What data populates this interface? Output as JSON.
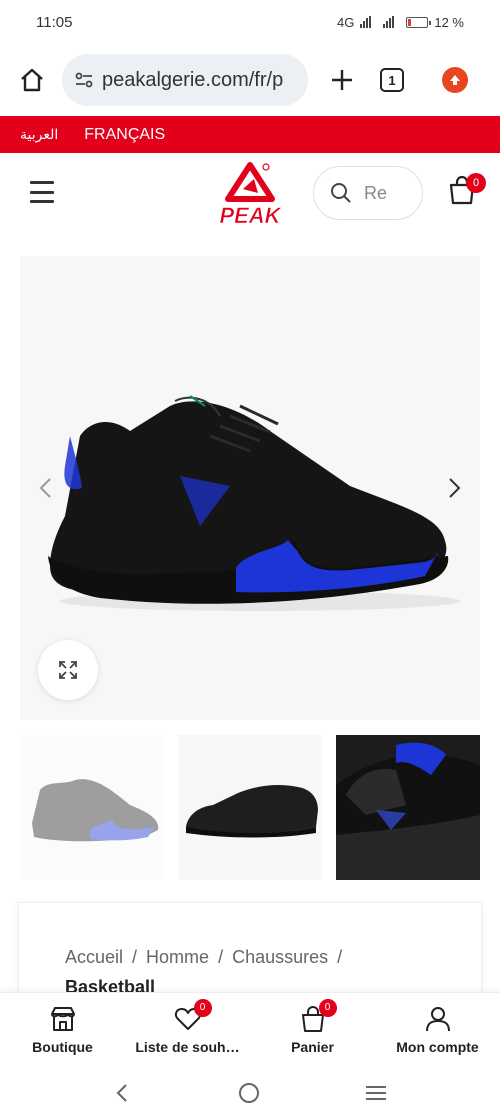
{
  "status_bar": {
    "time": "11:05",
    "network": "4G",
    "battery": "12 %"
  },
  "browser": {
    "url": "peakalgerie.com/fr/p",
    "tab_count": "1"
  },
  "language_bar": {
    "arabic": "العربية",
    "french": "FRANÇAIS"
  },
  "header": {
    "logo_text": "PEAK",
    "search_placeholder": "Re",
    "cart_count": "0"
  },
  "breadcrumb": {
    "items": [
      "Accueil",
      "Homme",
      "Chaussures"
    ],
    "current": "Basketball",
    "separator": "/"
  },
  "bottom_nav": {
    "items": [
      {
        "label": "Boutique",
        "icon": "store-icon"
      },
      {
        "label": "Liste de souh…",
        "icon": "heart-icon",
        "badge": "0"
      },
      {
        "label": "Panier",
        "icon": "cart-icon",
        "badge": "0"
      },
      {
        "label": "Mon compte",
        "icon": "user-icon"
      }
    ]
  },
  "colors": {
    "brand_red": "#e2001a",
    "accent_blue": "#1d35d6"
  }
}
